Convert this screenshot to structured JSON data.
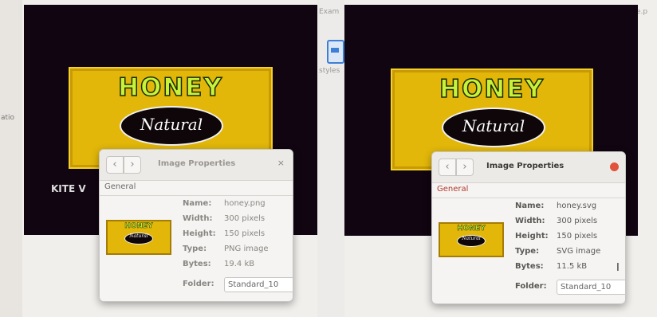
{
  "background": {
    "left_partial_text": "atio",
    "right_partial_top": "Exam",
    "right_partial_styles": "styles",
    "far_right_partial": "e.p"
  },
  "left_image": {
    "brand": "HONEY",
    "script_text": "Natural",
    "caption": "KITE V",
    "colors": {
      "background": "#100510",
      "label": "#e2b70a",
      "title": "#c8f23a"
    }
  },
  "right_image": {
    "brand": "HONEY",
    "script_text": "Natural"
  },
  "dialog_png": {
    "title": "Image Properties",
    "close_glyph": "×",
    "tab": "General",
    "thumb": {
      "brand": "HONEY",
      "script": "Natural"
    },
    "fields": {
      "name_label": "Name:",
      "name_value": "honey.png",
      "width_label": "Width:",
      "width_value": "300 pixels",
      "height_label": "Height:",
      "height_value": "150 pixels",
      "type_label": "Type:",
      "type_value": "PNG image",
      "bytes_label": "Bytes:",
      "bytes_value": "19.4 kB",
      "folder_label": "Folder:",
      "folder_value": "Standard_10"
    }
  },
  "dialog_svg": {
    "title": "Image Properties",
    "tab": "General",
    "thumb": {
      "brand": "HONEY",
      "script": "Natural"
    },
    "fields": {
      "name_label": "Name:",
      "name_value": "honey.svg",
      "width_label": "Width:",
      "width_value": "300 pixels",
      "height_label": "Height:",
      "height_value": "150 pixels",
      "type_label": "Type:",
      "type_value": "SVG image",
      "bytes_label": "Bytes:",
      "bytes_value": "11.5 kB",
      "folder_label": "Folder:",
      "folder_value": "Standard_10"
    }
  }
}
